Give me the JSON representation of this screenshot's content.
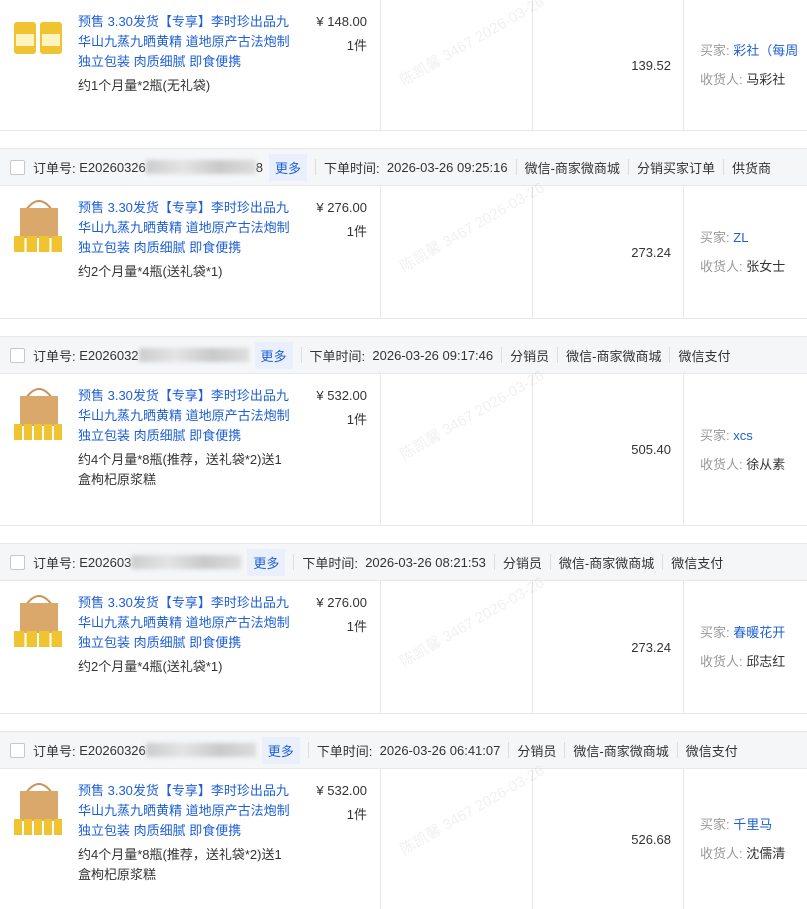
{
  "labels": {
    "order_no": "订单号:",
    "more": "更多",
    "order_time": "下单时间:",
    "buyer": "买家:",
    "receiver": "收货人:"
  },
  "product_title": "预售 3.30发货【专享】李时珍出品九华山九蒸九晒黄精 道地原产古法炮制 独立包装 肉质细腻 即食便携",
  "watermark": "陈凯馨 3467 2026-03-26",
  "orders": [
    {
      "sku": "约1个月量*2瓶(无礼袋)",
      "price": "¥ 148.00",
      "qty": "1件",
      "amount": "139.52",
      "buyer": "彩社（每周",
      "receiver": "马彩社"
    },
    {
      "order_no": "E20260326",
      "order_no_tail": "8",
      "time": "2026-03-26 09:25:16",
      "tags": [
        "微信-商家微商城",
        "分销买家订单",
        "供货商"
      ],
      "sku": "约2个月量*4瓶(送礼袋*1)",
      "price": "¥ 276.00",
      "qty": "1件",
      "amount": "273.24",
      "buyer": "ZL",
      "receiver": "张女士"
    },
    {
      "order_no": "E2026032",
      "time": "2026-03-26 09:17:46",
      "tags": [
        "分销员",
        "微信-商家微商城",
        "微信支付"
      ],
      "sku": "约4个月量*8瓶(推荐，送礼袋*2)送1盒枸杞原浆糕",
      "price": "¥ 532.00",
      "qty": "1件",
      "amount": "505.40",
      "buyer": "xcs",
      "receiver": "徐从素"
    },
    {
      "order_no": "E202603",
      "time": "2026-03-26 08:21:53",
      "tags": [
        "分销员",
        "微信-商家微商城",
        "微信支付"
      ],
      "sku": "约2个月量*4瓶(送礼袋*1)",
      "price": "¥ 276.00",
      "qty": "1件",
      "amount": "273.24",
      "buyer": "春暖花开",
      "receiver": "邱志红"
    },
    {
      "order_no": "E20260326",
      "time": "2026-03-26 06:41:07",
      "tags": [
        "分销员",
        "微信-商家微商城",
        "微信支付"
      ],
      "sku": "约4个月量*8瓶(推荐，送礼袋*2)送1盒枸杞原浆糕",
      "price": "¥ 532.00",
      "qty": "1件",
      "amount": "526.68",
      "buyer": "千里马",
      "receiver": "沈儒清"
    }
  ]
}
